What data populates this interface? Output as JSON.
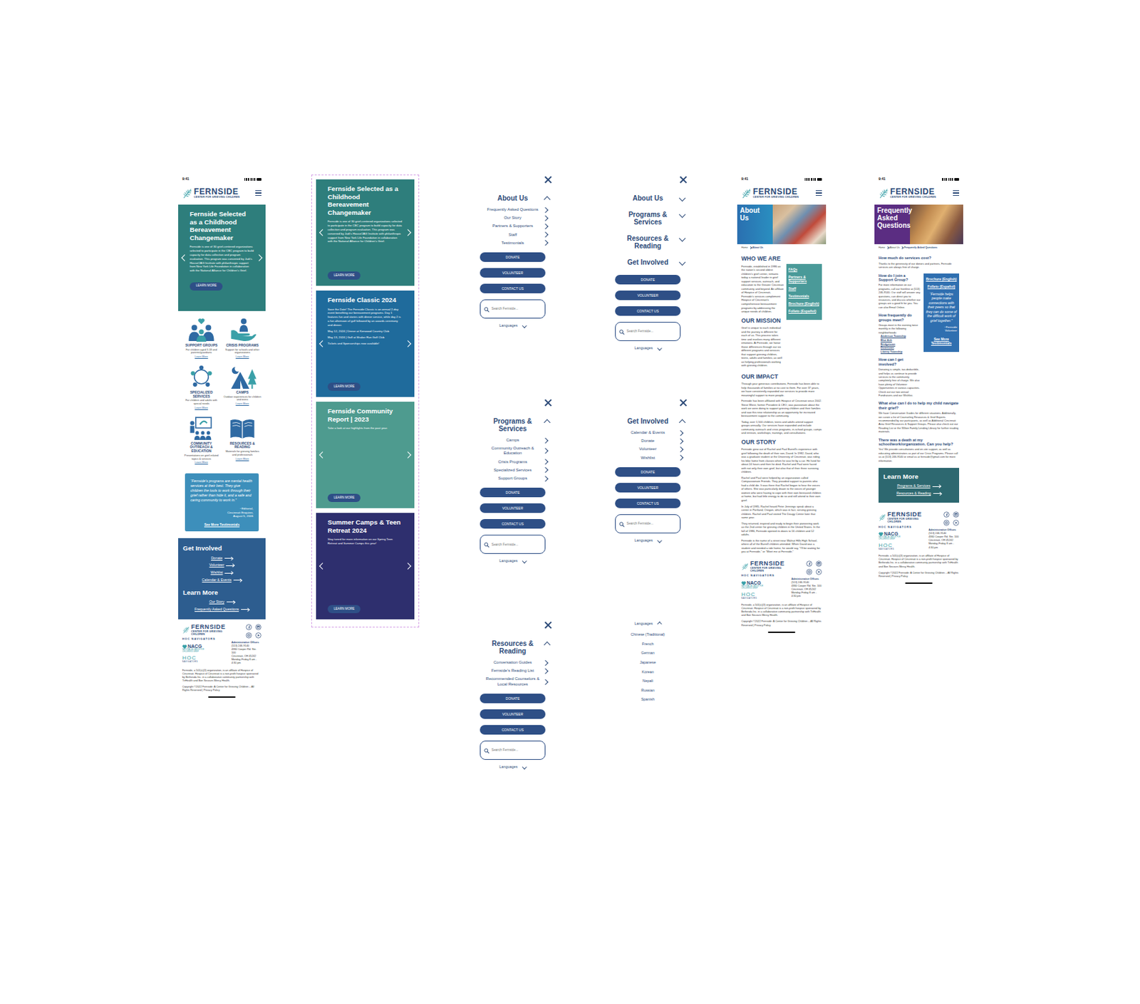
{
  "status_time": "9:41",
  "logo": {
    "name": "FERNSIDE",
    "tagline": "CENTER FOR GRIEVING CHILDREN"
  },
  "home": {
    "hero": {
      "title": "Fernside Selected as a Childhood Bereavement Changemaker",
      "body": [
        "Fernside is one of 30 grief-centered organizations selected to participate in the CBC program to build capacity for data collection and program evaluation. This program was convened by Judi's House/JAG Institute with philanthropic support from New York Life Foundation in collaboration with the National Alliance for Children's Grief."
      ],
      "button": "LEARN MORE",
      "color": "#2e7e7c"
    },
    "services": [
      {
        "title": "SUPPORT GROUPS",
        "desc": "For children aged 3-18 and parents/guardians",
        "link": "Learn More"
      },
      {
        "title": "CRISIS PROGRAMS",
        "desc": "Support for schools and other organizations",
        "link": "Learn More"
      },
      {
        "title": "SPECIALIZED SERVICES",
        "desc": "For children and adults with special needs",
        "link": "Learn More"
      },
      {
        "title": "CAMPS",
        "desc": "Outdoor experiences for children and teens",
        "link": "Learn More"
      },
      {
        "title": "COMMUNITY OUTREACH & EDUCATION",
        "desc": "Presentations on grief-related topics & services",
        "link": "Learn More"
      },
      {
        "title": "RESOURCES & READING",
        "desc": "Materials for grieving families and professionals",
        "link": "Learn More"
      }
    ],
    "quote": {
      "text": "“Fernside's programs are mental health services at their best. They give children the tools to work through their grief rather than hide it, and a safe and caring community to work in.”",
      "attribution": [
        "~Editorial,",
        "Cincinnati Enquirer,",
        "August 5, 2006"
      ],
      "link": "See More Testimonials"
    },
    "get_involved": {
      "title": "Get Involved",
      "links": [
        "Donate",
        "Volunteer",
        "Wishlist",
        "Calendar & Events"
      ]
    },
    "learn_more": {
      "title": "Learn More",
      "links": [
        "Our Story",
        "Frequently Asked Questions"
      ]
    }
  },
  "slides": [
    {
      "title": "Fernside Selected as a Childhood Bereavement Changemaker",
      "body": [
        "Fernside is one of 30 grief-centered organizations selected to participate in the CBC program to build capacity for data collection and program evaluation. This program was convened by Judi's House/JAG Institute with philanthropic support from New York Life Foundation in collaboration with the National Alliance for Children's Grief."
      ],
      "button": "LEARN MORE",
      "color": "#2e7e7c"
    },
    {
      "title": "Fernside Classic 2024",
      "body": [
        "Save the Date! The Fernside Classic is an annual 2-day event benefiting our bereavement programs. Day 1 features fun and stories with dinner service, while day 2 is a fun afternoon of golf followed by an awards ceremony and dinner.",
        "May 12, 2024 | Dinner at Kenwood Country Club",
        "May 13, 2024 | Golf at Shaker Run Golf Club",
        "Tickets and Sponsorships now available!"
      ],
      "button": "LEARN MORE",
      "color": "#1f6b9c"
    },
    {
      "title": "Fernside Community Report | 2023",
      "body": [
        "Take a look at our highlights from the past year."
      ],
      "button": "LEARN MORE",
      "color": "#4e9b8f"
    },
    {
      "title": "Summer Camps & Teen Retreat 2024",
      "body": [
        "Stay tuned for more information on our Spring Teen Retreat and Summer Camps this year!"
      ],
      "button": "LEARN MORE",
      "color": "#2e2f6e"
    }
  ],
  "menu_common": {
    "buttons": [
      "DONATE",
      "VOLUNTEER",
      "CONTACT US"
    ],
    "search_placeholder": "Search Fernside...",
    "languages": "Languages"
  },
  "menus": [
    {
      "sections": [
        {
          "label": "About Us",
          "expanded": true,
          "items": [
            "Frequently Asked Questions",
            "Our Story",
            "Partners & Supporters",
            "Staff",
            "Testimonials"
          ]
        }
      ],
      "languages_expanded": false
    },
    {
      "sections": [
        {
          "label": "Programs & Services",
          "expanded": true,
          "items": [
            "Camps",
            "Community Outreach & Education",
            "Crisis Programs",
            "Specialized Services",
            "Support Groups"
          ]
        }
      ],
      "languages_expanded": false
    },
    {
      "sections": [
        {
          "label": "Resources & Reading",
          "expanded": true,
          "items": [
            "Conversation Guides",
            "Fernside's Reading List",
            "Recommended Counselors & Local Resources"
          ]
        }
      ],
      "languages_expanded": false
    },
    {
      "sections": [
        {
          "label": "About Us",
          "expanded": false,
          "items": []
        },
        {
          "label": "Programs & Services",
          "expanded": false,
          "items": []
        },
        {
          "label": "Resources & Reading",
          "expanded": false,
          "items": []
        },
        {
          "label": "Get Involved",
          "expanded": false,
          "items": []
        }
      ],
      "languages_expanded": false
    },
    {
      "sections": [
        {
          "label": "Get Involved",
          "expanded": true,
          "items": [
            "Calendar & Events",
            "Donate",
            "Volunteer",
            "Wishlist"
          ]
        }
      ],
      "languages_expanded": false
    }
  ],
  "languages_menu": {
    "label": "Languages",
    "expanded": true,
    "options": [
      "Chinese (Traditional)",
      "French",
      "German",
      "Japanese",
      "Korean",
      "Nepali",
      "Russian",
      "Spanish"
    ]
  },
  "about": {
    "hero_title": "About Us",
    "breadcrumb": [
      "Home",
      "About Us"
    ],
    "sidebar": [
      "FAQs",
      "Partners & Supporters",
      "Staff",
      "Testimonials",
      "Brochure (English)",
      "Folleto (Español)"
    ],
    "who": {
      "title": "WHO WE ARE",
      "text": "Fernside, established in 1986 as the nation's second oldest children's grief center, remains today a national leader in grief support services, outreach, and education to the Greater Cincinnati community and beyond. An affiliate of Hospice of Cincinnati, Fernside's services complement Hospice of Cincinnati's comprehensive bereavement programs by addressing the unique needs of children."
    },
    "mission": {
      "title": "OUR MISSION",
      "text": "Grief is unique to each individual and the journey is different for each of us. This process takes time and involves many different emotions. At Fernside, we honor those differences through our six different programs and services that support grieving children, teens, adults and families, as well as helping professionals working with grieving children."
    },
    "impact": {
      "title": "OUR IMPACT",
      "paragraphs": [
        "Through your generous contributions, Fernside has been able to help thousands of families at no cost to them. For over 37 years, we have consistently expanded our services to provide more meaningful support to more people.",
        "Fernside has been affiliated with Hospice of Cincinnati since 2002. Steve Wiest, former President & CEO, was passionate about the work we were doing to support grieving children and their families and saw this new relationship as an opportunity for increased bereavement support to the community.",
        "Today, over 1,500 children, teens and adults attend support groups annually. Our services have expanded and include community outreach and crisis programs, in-school groups, camps and retreats, workshops, trainings, and consultations."
      ]
    },
    "story": {
      "title": "OUR STORY",
      "paragraphs": [
        "Fernside grew out of Rachel and Paul Burrell's experience with grief following the death of their son, David. In 1982, David, who was a graduate student at the University of Cincinnati, was riding his bike home from classes when he was hit by a car. He lived for about 24 hours and then he died. Rachel and Paul were faced with not only their own grief, but also that of their three surviving children.",
        "Rachel and Paul were helped by an organization called Compassionate Friends. They provided support to parents who had a child die. It was there that Rachel began to hear the voices of others. She was particularly drawn to the voices of younger women who were having to cope with their own bereaved children at home, but had little energy to do so and still attend to their own grief.",
        "In July of 1985, Rachel heard Peter Jennings speak about a center in Portland, Oregon, which was in fact, serving grieving children. Rachel and Paul visited The Dougy Center later that same year.",
        "They returned, inspired and ready to begin their pioneering work as the 2nd center for grieving children in the United States. In the fall of 1986, Fernside opened its doors to 16 children and 12 adults.",
        "Fernside is the name of a street near Walnut Hills High School, where all of the Burrell children attended. When David was a student and needed a ride home, he would say, \"I'll be waiting for you at Fernside,\" or \"Meet me at Fernside.\""
      ]
    }
  },
  "faq": {
    "hero_title": "Frequently Asked Questions",
    "breadcrumb": [
      "Home",
      "About Us",
      "Frequently Asked Questions"
    ],
    "sidebar": {
      "links": [
        "Brochure (English)",
        "Folleto (Español)"
      ],
      "quote": "“Fernside helps people make connections with their peers so that they can do some of the difficult work of grief together.”",
      "attribution": [
        "~Fernside",
        "Volunteer"
      ],
      "link": "See More Testimonials"
    },
    "intro": [
      {
        "q": "How much do services cost?",
        "a": "Thanks to the generosity of our donors and partners, Fernside services are always free of charge."
      }
    ],
    "side_questions": [
      {
        "q": "How do I join a Support Group?",
        "a": "For more information on our programs, call our frontline at (513) 246-9140. Our staff will answer any questions, can direct you to resources, and discuss whether our groups are a good fit for you. You can also Email Online.",
        "towns": []
      },
      {
        "q": "How frequently do groups meet?",
        "a": "Groups meet in the evening twice monthly in the following neighborhoods:",
        "towns": [
          "Anderson Township",
          "Blue Ash",
          "Bridgetown",
          "Downtown",
          "Liberty Township"
        ]
      },
      {
        "q": "How can I get involved?",
        "a": "Donating is simple, tax-deductible, and helps us continue to provide services to the community completely free of charge. We also have plenty of Volunteer Opportunities in various capacities. Check out our two annual Fundraisers and our Wishlist.",
        "towns": []
      }
    ],
    "questions": [
      {
        "q": "What else can I do to help my child navigate their grief?",
        "a": "We have Conversation Guides for different situations. Additionally, we curate a list of Counseling Resources & Grief Experts recommended by our participants, as well as Additional Cincinnati Area Grief Resources & Support Groups. Please also check out our Reading List or the Wilton Family Lending Library for further reading materials."
      },
      {
        "q": "There was a death at my school/work/organization. Can you help?",
        "a": "Yes! We provide consultations and on-site support, as well as educating administrators as part of our Crisis Programs. Please call us at (513) 246-9140 or email us at fernside@gmail.com for more information."
      }
    ],
    "learn_more": {
      "title": "Learn More",
      "links": [
        "Programs & Services",
        "Resources & Reading"
      ]
    }
  },
  "footer": {
    "hoc_line": "HOC NAVIGATORS",
    "nacg": "NACG",
    "nacg_sub": "NATIONAL ALLIANCE FOR CHILDREN'S GRIEF",
    "hoc": "HOC",
    "hoc_sub": "NAVIGATORS",
    "office_title": "Administrative Offices",
    "office_lines": [
      "(513) 246-9140",
      "4360 Cooper Rd. Ste. 100",
      "Cincinnati, OH 45242",
      "Monday-Friday 8 am - 4:30 pm"
    ],
    "about": "Fernside, a 501(c)(3) organization, is an affiliate of Hospice of Cincinnati. Hospice of Cincinnati is a non-profit hospice sponsored by Bethesda Inc. in a collaborative community partnership with TriHealth and Bon Secours Mercy Health.",
    "copyright": "Copyright ©2022 Fernside: A Center for Grieving Children – All Rights Reserved | Privacy Policy"
  }
}
